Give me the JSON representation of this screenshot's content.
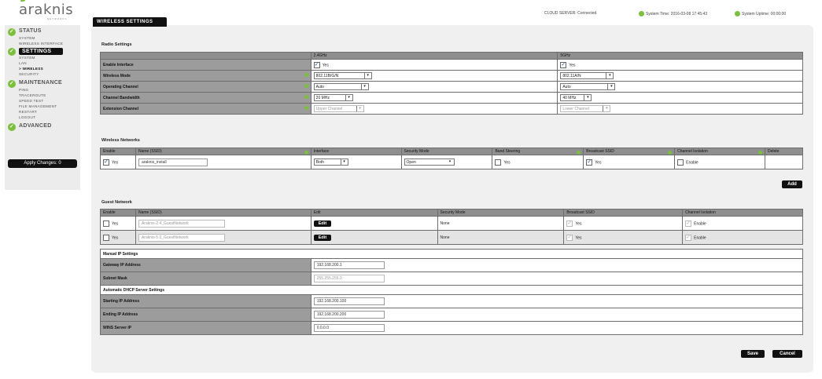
{
  "brand": {
    "logo": "araknis",
    "subtitle": "NETWORKS"
  },
  "header": {
    "cloud": "CLOUD SERVER: Connected",
    "time": "System Time: 2016-03-08 17:45:43",
    "uptime": "System Uptime: 00:00:00"
  },
  "sidebar": {
    "status": "STATUS",
    "status_items": [
      "SYSTEM",
      "WIRELESS INTERFACE"
    ],
    "settings": "SETTINGS",
    "settings_items": [
      "SYSTEM",
      "LAN",
      "WIRELESS",
      "SECURITY"
    ],
    "maintenance": "MAINTENANCE",
    "maintenance_items": [
      "PING",
      "TRACEROUTE",
      "SPEED TEST",
      "FILE MANAGEMENT",
      "RESTART",
      "LOGOUT"
    ],
    "advanced": "ADVANCED",
    "apply": "Apply Changes: 0"
  },
  "page_title": "WIRELESS SETTINGS",
  "radio": {
    "title": "Radio Settings",
    "col_24": "2.4GHz",
    "col_5": "5GHz",
    "enable_label": "Enable Interface",
    "enable_24": "Yes",
    "enable_5": "Yes",
    "mode_label": "Wireless Mode",
    "mode_24": "802.11B/G/N",
    "mode_5": "802.11A/N",
    "channel_label": "Operating Channel",
    "channel_24": "Auto",
    "channel_5": "Auto",
    "bw_label": "Channel Bandwidth",
    "bw_24": "20 MHz",
    "bw_5": "40 MHz",
    "ext_label": "Extension Channel",
    "ext_24": "Upper Channel",
    "ext_5": "Lower Channel"
  },
  "wireless": {
    "title": "Wireless Networks",
    "headers": [
      "Enable",
      "Name (SSID)",
      "Interface",
      "Security Mode",
      "Band Steering",
      "Broadcast SSID",
      "Channel Isolation",
      "Delete"
    ],
    "row": {
      "enable": "Yes",
      "ssid": "araknis_install",
      "interface": "Both",
      "security": "Open",
      "band": "Yes",
      "broadcast": "Yes",
      "isolation": "Enable"
    },
    "add": "Add"
  },
  "guest": {
    "title": "Guest Network",
    "headers": [
      "Enable",
      "Name (SSID)",
      "Edit",
      "Security Mode",
      "Broadcast SSID",
      "Channel Isolation"
    ],
    "rows": [
      {
        "enable": "Yes",
        "ssid": "Araknis-2.4_GuestNetwork",
        "edit": "Edit",
        "security": "None",
        "broadcast": "Yes",
        "isolation": "Enable"
      },
      {
        "enable": "Yes",
        "ssid": "Araknis-5.0_GuestNetwork",
        "edit": "Edit",
        "security": "None",
        "broadcast": "Yes",
        "isolation": "Enable"
      }
    ],
    "manual_ip": "Manual IP Settings",
    "gateway_label": "Gateway IP Address",
    "gateway": "192.168.200.1",
    "subnet_label": "Subnet Mask",
    "subnet": "255.255.255.0",
    "dhcp": "Automatic DHCP Server Settings",
    "start_label": "Starting IP Address",
    "start": "192.168.200.100",
    "end_label": "Ending IP Address",
    "end": "192.168.200.200",
    "wins_label": "WINS Server IP",
    "wins": "0.0.0.0"
  },
  "actions": {
    "save": "Save",
    "cancel": "Cancel"
  }
}
